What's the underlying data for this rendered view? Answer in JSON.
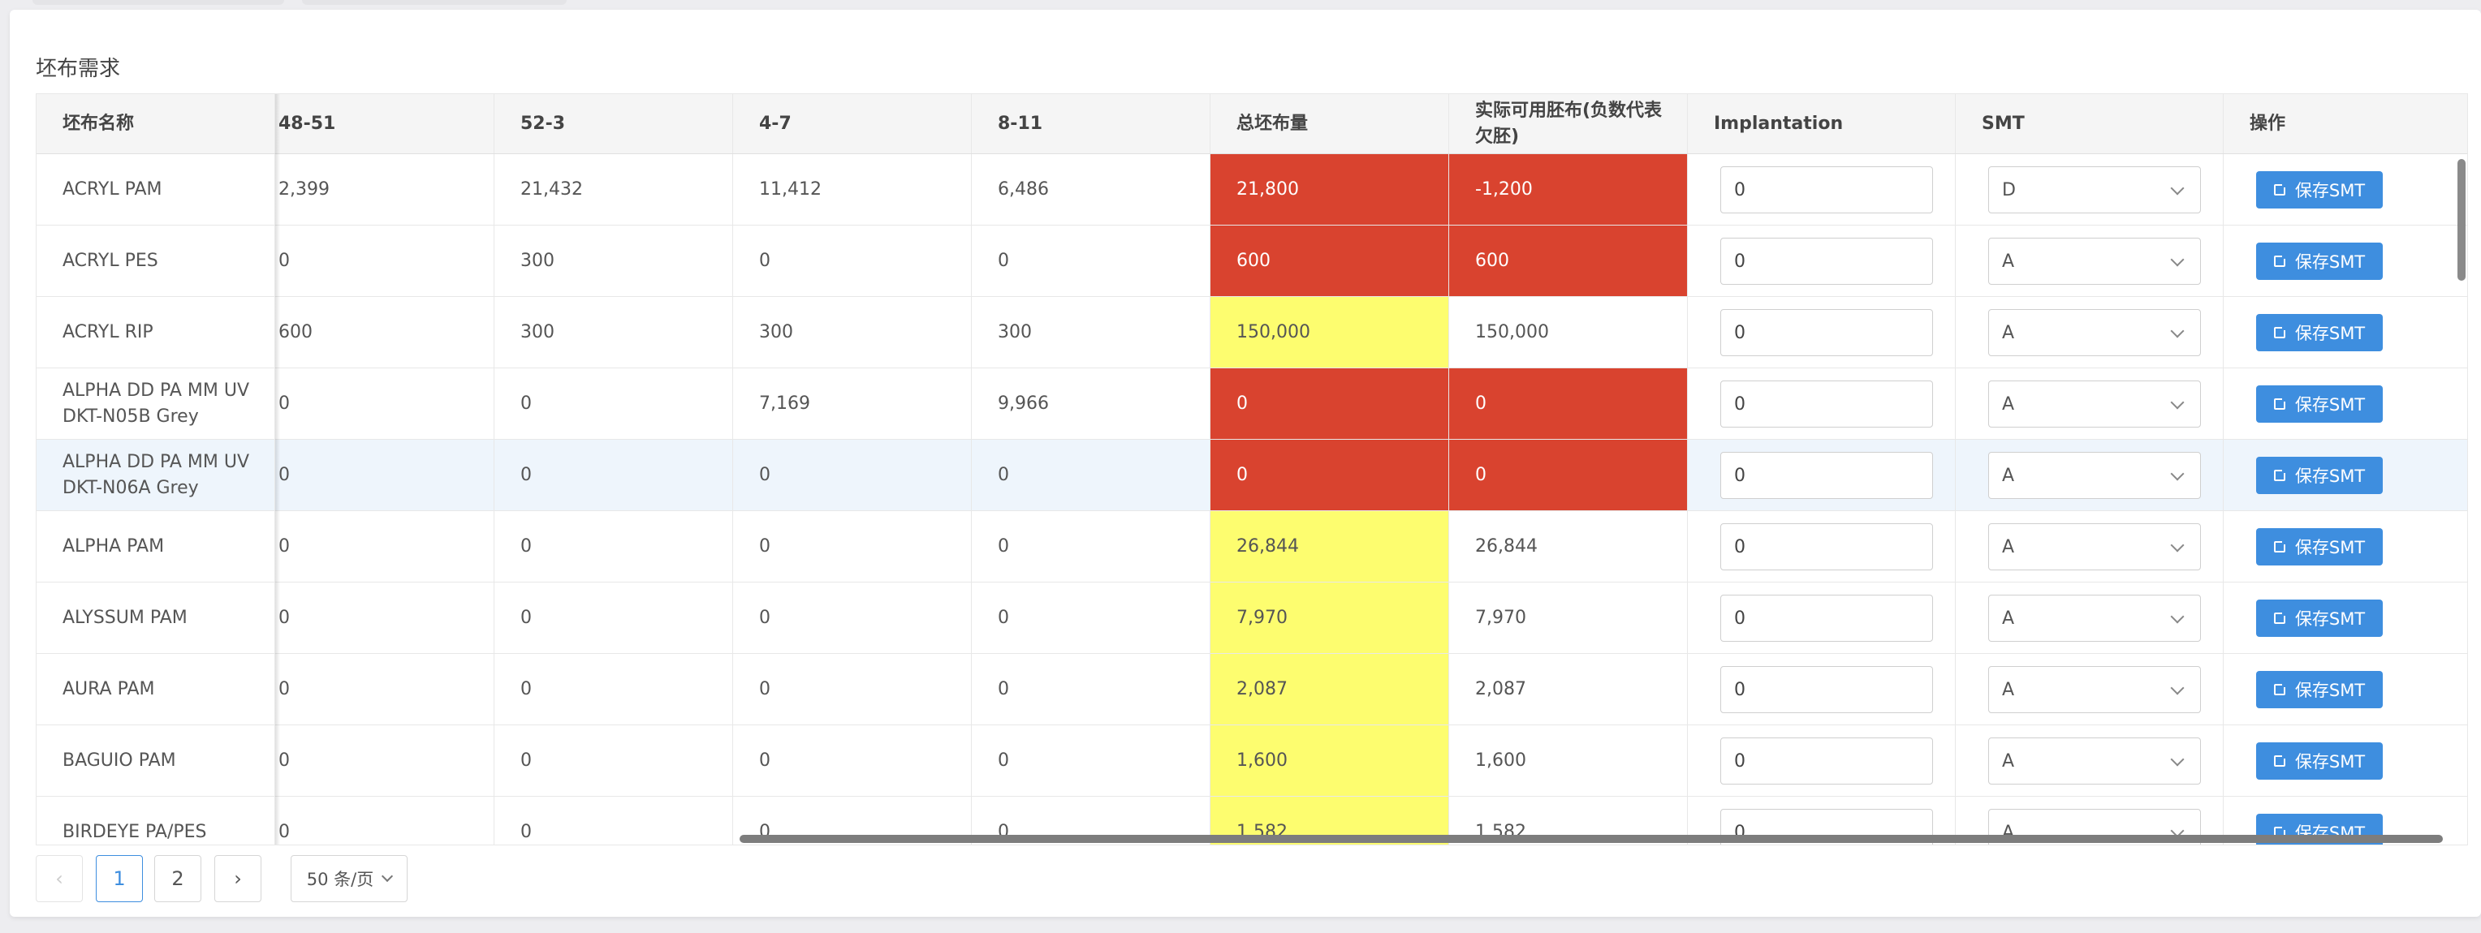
{
  "title": "坯布需求",
  "columns": [
    "坯布名称",
    "48-51",
    "52-3",
    "4-7",
    "8-11",
    "总坯布量",
    "实际可用胚布(负数代表欠胚)",
    "Implantation",
    "SMT",
    "操作"
  ],
  "rows": [
    {
      "name": "ACRYL PAM",
      "w1": "2,399",
      "w2": "21,432",
      "w3": "11,412",
      "w4": "6,486",
      "total": "21,800",
      "total_status": "red",
      "available": "-1,200",
      "available_status": "red",
      "implantation": "0",
      "smt": "D",
      "action": "保存SMT"
    },
    {
      "name": "ACRYL PES",
      "w1": "0",
      "w2": "300",
      "w3": "0",
      "w4": "0",
      "total": "600",
      "total_status": "red",
      "available": "600",
      "available_status": "red",
      "implantation": "0",
      "smt": "A",
      "action": "保存SMT"
    },
    {
      "name": "ACRYL RIP",
      "w1": "600",
      "w2": "300",
      "w3": "300",
      "w4": "300",
      "total": "150,000",
      "total_status": "yellow",
      "available": "150,000",
      "available_status": "none",
      "implantation": "0",
      "smt": "A",
      "action": "保存SMT"
    },
    {
      "name": "ALPHA DD PA MM UV DKT-N05B Grey",
      "w1": "0",
      "w2": "0",
      "w3": "7,169",
      "w4": "9,966",
      "total": "0",
      "total_status": "red",
      "available": "0",
      "available_status": "red",
      "implantation": "0",
      "smt": "A",
      "action": "保存SMT"
    },
    {
      "name": "ALPHA DD PA MM UV DKT-N06A Grey",
      "w1": "0",
      "w2": "0",
      "w3": "0",
      "w4": "0",
      "total": "0",
      "total_status": "red",
      "available": "0",
      "available_status": "red",
      "implantation": "0",
      "smt": "A",
      "action": "保存SMT"
    },
    {
      "name": "ALPHA PAM",
      "w1": "0",
      "w2": "0",
      "w3": "0",
      "w4": "0",
      "total": "26,844",
      "total_status": "yellow",
      "available": "26,844",
      "available_status": "none",
      "implantation": "0",
      "smt": "A",
      "action": "保存SMT"
    },
    {
      "name": "ALYSSUM PAM",
      "w1": "0",
      "w2": "0",
      "w3": "0",
      "w4": "0",
      "total": "7,970",
      "total_status": "yellow",
      "available": "7,970",
      "available_status": "none",
      "implantation": "0",
      "smt": "A",
      "action": "保存SMT"
    },
    {
      "name": "AURA PAM",
      "w1": "0",
      "w2": "0",
      "w3": "0",
      "w4": "0",
      "total": "2,087",
      "total_status": "yellow",
      "available": "2,087",
      "available_status": "none",
      "implantation": "0",
      "smt": "A",
      "action": "保存SMT"
    },
    {
      "name": "BAGUIO PAM",
      "w1": "0",
      "w2": "0",
      "w3": "0",
      "w4": "0",
      "total": "1,600",
      "total_status": "yellow",
      "available": "1,600",
      "available_status": "none",
      "implantation": "0",
      "smt": "A",
      "action": "保存SMT"
    },
    {
      "name": "BIRDEYE PA/PES",
      "w1": "0",
      "w2": "0",
      "w3": "0",
      "w4": "0",
      "total": "1,582",
      "total_status": "yellow",
      "available": "1,582",
      "available_status": "none",
      "implantation": "0",
      "smt": "A",
      "action": "保存SMT"
    }
  ],
  "pagination": {
    "prev": "‹",
    "pages": [
      "1",
      "2"
    ],
    "next": "›",
    "current": "1",
    "page_size": "50 条/页"
  },
  "colors": {
    "red": "#d9432f",
    "yellow": "#fdfd6f",
    "primary": "#3e8edf"
  }
}
